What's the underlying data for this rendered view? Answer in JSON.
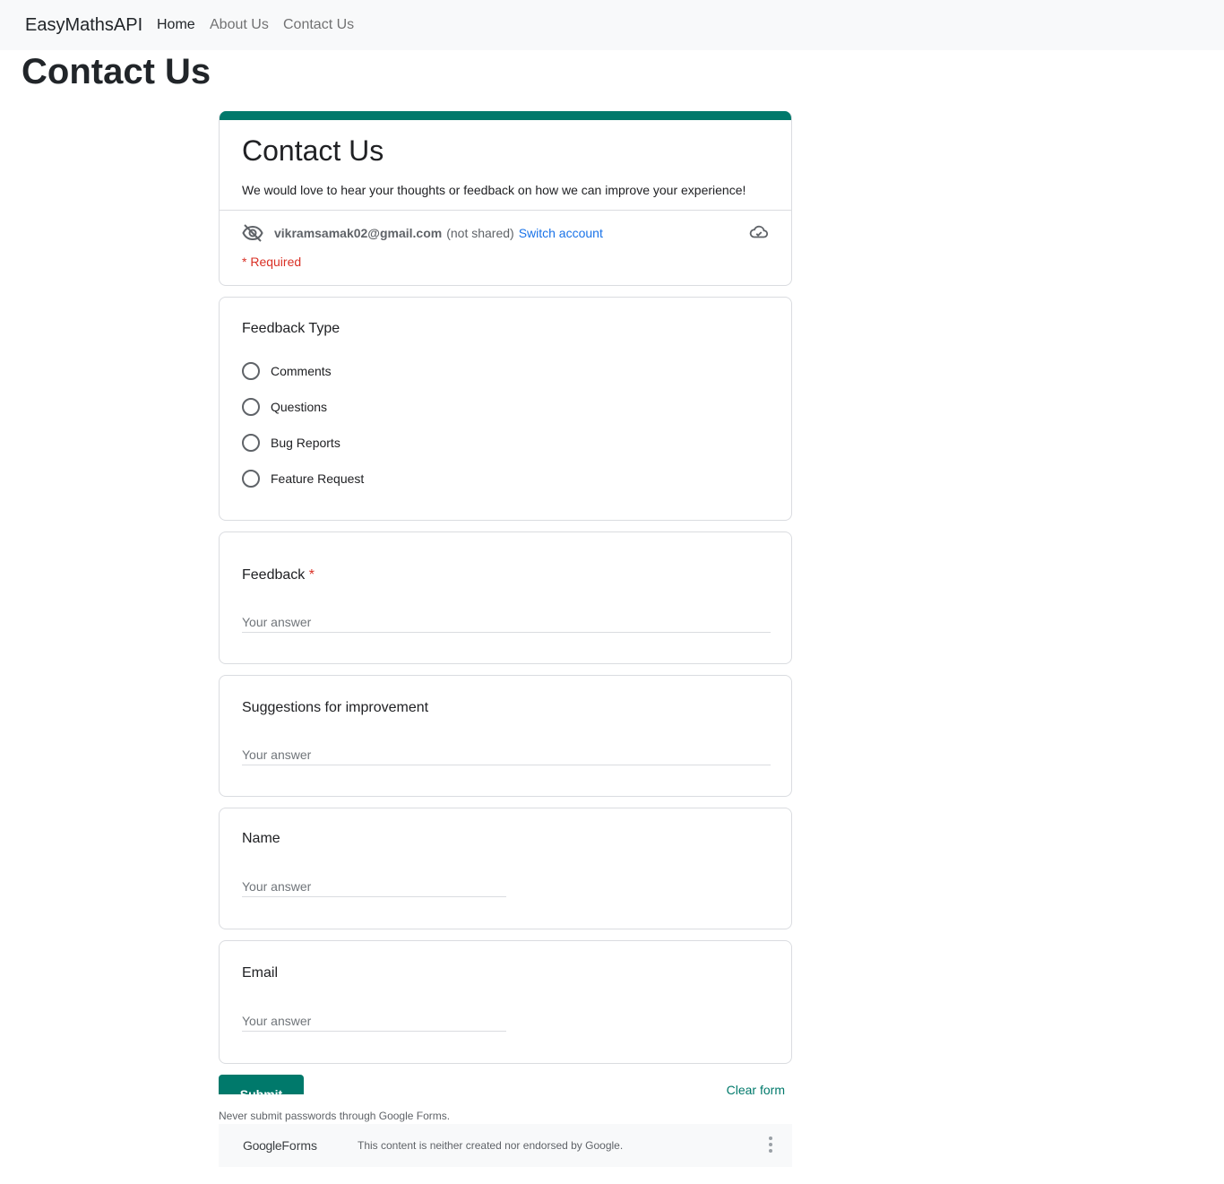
{
  "navbar": {
    "brand": "EasyMathsAPI",
    "links": [
      {
        "label": "Home",
        "active": true
      },
      {
        "label": "About Us",
        "active": false
      },
      {
        "label": "Contact Us",
        "active": false
      }
    ]
  },
  "page": {
    "title": "Contact Us"
  },
  "form": {
    "accent_color": "#00796b",
    "title": "Contact Us",
    "description": "We would love to hear your thoughts or feedback on how we can improve your experience!",
    "account": {
      "email": "vikramsamak02@gmail.com",
      "not_shared": "(not shared)",
      "switch_label": "Switch account"
    },
    "required_note": "* Required",
    "feedback_type": {
      "title": "Feedback Type",
      "options": [
        "Comments",
        "Questions",
        "Bug Reports",
        "Feature Request"
      ]
    },
    "feedback": {
      "title": "Feedback",
      "required_mark": "*",
      "placeholder": "Your answer"
    },
    "suggestions": {
      "title": "Suggestions for improvement",
      "placeholder": "Your answer"
    },
    "name": {
      "title": "Name",
      "placeholder": "Your answer"
    },
    "email": {
      "title": "Email",
      "placeholder": "Your answer"
    },
    "submit_label": "Submit",
    "clear_label": "Clear form",
    "never_note": "Never submit passwords through Google Forms.",
    "footer": {
      "logo_google": "Google",
      "logo_forms": "Forms",
      "disclaimer": "This content is neither created nor endorsed by Google."
    }
  }
}
